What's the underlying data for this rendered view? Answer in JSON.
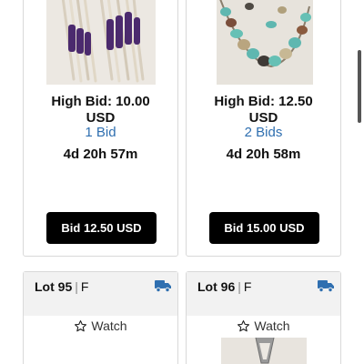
{
  "items": [
    {
      "image_icon": "beaded-necklace-photo",
      "high_bid_line1": "High Bid: 10.00",
      "high_bid_line2": "USD",
      "bids": "1 Bid",
      "time_left": "4d 20h 57m",
      "bid_button": "Bid 12.50 USD"
    },
    {
      "image_icon": "turquoise-necklace-photo",
      "high_bid_line1": "High Bid: 12.50",
      "high_bid_line2": "USD",
      "bids": "2 Bids",
      "time_left": "4d 20h 58m",
      "bid_button": "Bid 15.00 USD"
    }
  ],
  "lots": [
    {
      "lot_label": "Lot 95",
      "sep": "|",
      "suffix": "F",
      "watch": "Watch",
      "shipping_icon": "truck-icon",
      "watch_icon": "star-outline-icon"
    },
    {
      "lot_label": "Lot 96",
      "sep": "|",
      "suffix": "F",
      "watch": "Watch",
      "shipping_icon": "truck-icon",
      "watch_icon": "star-outline-icon",
      "image_icon": "silver-pendant-photo"
    }
  ],
  "colors": {
    "bid_count": "#2f6fb0",
    "button_bg": "#000000",
    "truck": "#2f6fb0",
    "header_bg": "#f2f2f2"
  }
}
